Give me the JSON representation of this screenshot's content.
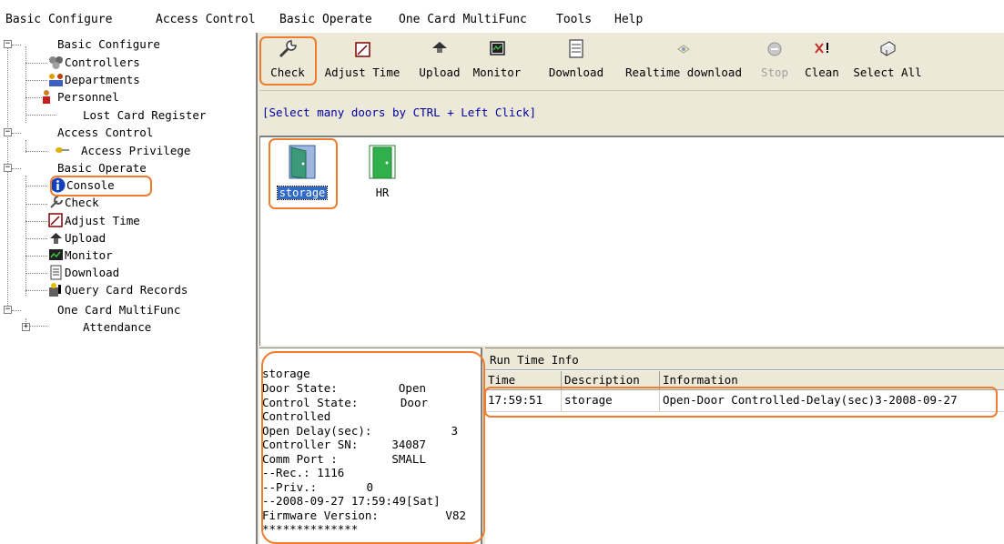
{
  "menu": [
    "Basic Configure",
    "Access Control",
    "Basic Operate",
    "One Card MultiFunc",
    "Tools",
    "Help"
  ],
  "tree": {
    "basic_configure": "Basic Configure",
    "controllers": "Controllers",
    "departments": "Departments",
    "personnel": "Personnel",
    "lost_card": "Lost Card Register",
    "access_control": "Access Control",
    "access_privilege": "Access Privilege",
    "basic_operate": "Basic Operate",
    "console": "Console",
    "check": "Check",
    "adjust_time": "Adjust Time",
    "upload": "Upload",
    "monitor": "Monitor",
    "download": "Download",
    "query_records": "Query Card Records",
    "one_card": "One Card MultiFunc",
    "attendance": "Attendance"
  },
  "toolbar": {
    "check": "Check",
    "adjust_time": "Adjust Time",
    "upload": "Upload",
    "monitor": "Monitor",
    "download": "Download",
    "realtime_download": "Realtime download",
    "stop": "Stop",
    "clean": "Clean",
    "select_all": "Select All"
  },
  "hint": "[Select many doors by CTRL + Left Click]",
  "doors": [
    {
      "label": "storage",
      "selected": true,
      "color": "#3a9a7a"
    },
    {
      "label": "HR",
      "selected": false,
      "color": "#2fb04a"
    }
  ],
  "status": {
    "door_name": "storage",
    "door_state_label": "Door State:",
    "door_state_value": "Open",
    "control_state_label": "Control State:",
    "control_state_value": "Door",
    "control_state_cont": "Controlled",
    "open_delay_label": "Open Delay(sec):",
    "open_delay_value": "3",
    "controller_sn_label": "Controller SN:",
    "controller_sn_value": "34087",
    "comm_port_label": "Comm Port :",
    "comm_port_value": "SMALL",
    "rec_line": "--Rec.: 1116",
    "priv_label": "--Priv.:",
    "priv_value": "0",
    "time_line": "--2008-09-27 17:59:49[Sat]",
    "firmware_label": "Firmware Version:",
    "firmware_value": "V82",
    "stars": "**************"
  },
  "runtime": {
    "caption": "Run Time Info",
    "columns": [
      "Time",
      "Description",
      "Information"
    ],
    "rows": [
      {
        "time": "17:59:51",
        "description": "storage",
        "information": "Open-Door Controlled-Delay(sec)3-2008-09-27"
      }
    ]
  },
  "colors": {
    "callout": "#f07c2e",
    "selection": "#316ac5",
    "hint_text": "#0000a0"
  }
}
